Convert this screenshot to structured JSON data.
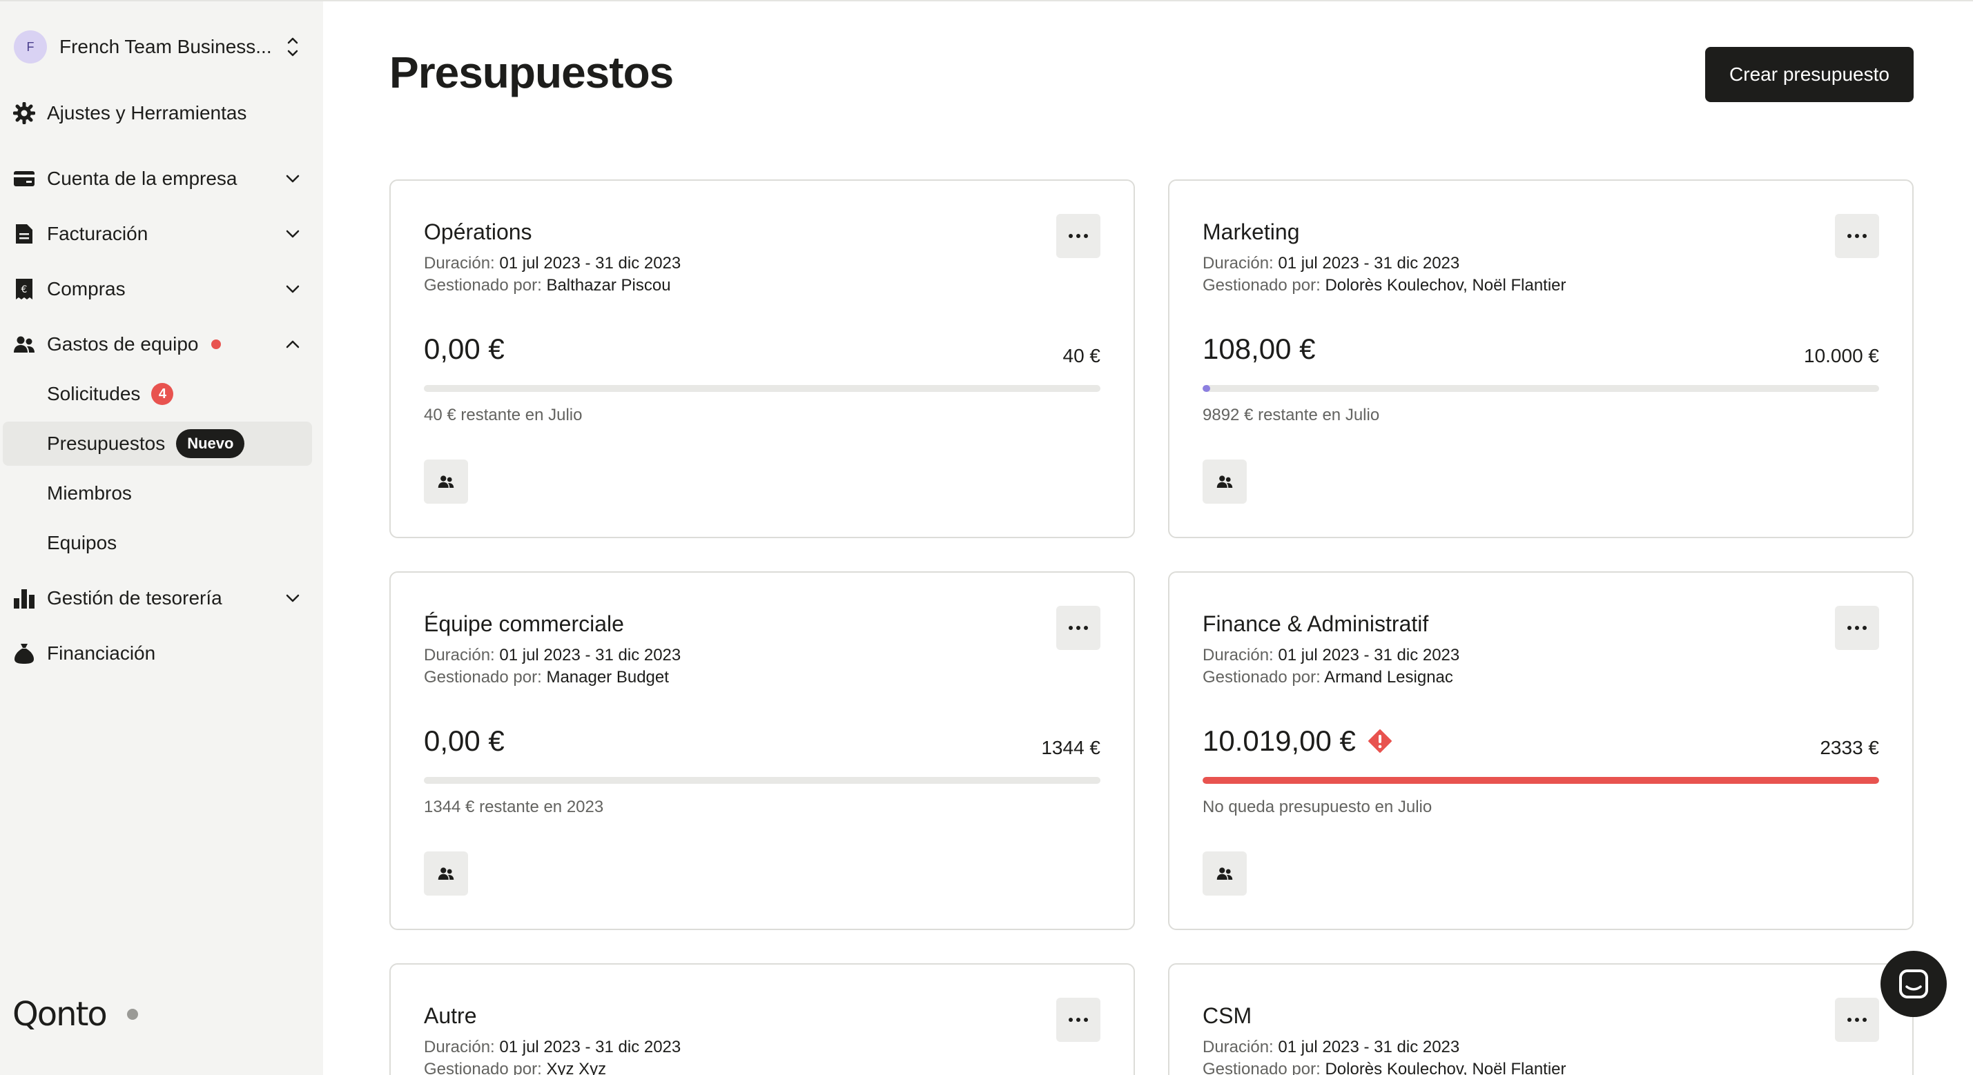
{
  "sidebar": {
    "org": {
      "initial": "F",
      "name": "French Team Business..."
    },
    "settings_label": "Ajustes y Herramientas",
    "items": [
      {
        "label": "Cuenta de la empresa"
      },
      {
        "label": "Facturación"
      },
      {
        "label": "Compras"
      },
      {
        "label": "Gastos de equipo"
      },
      {
        "label": "Gestión de tesorería"
      },
      {
        "label": "Financiación"
      }
    ],
    "sub_items": [
      {
        "label": "Solicitudes",
        "count": "4"
      },
      {
        "label": "Presupuestos",
        "badge": "Nuevo"
      },
      {
        "label": "Miembros"
      },
      {
        "label": "Equipos"
      }
    ],
    "brand": "Qonto"
  },
  "main": {
    "title": "Presupuestos",
    "create_label": "Crear presupuesto"
  },
  "labels": {
    "duration": "Duración:",
    "managed_by": "Gestionado por:"
  },
  "budgets": [
    {
      "name": "Opérations",
      "duration": "01 jul 2023 - 31 dic 2023",
      "managers": "Balthazar Piscou",
      "spent": "0,00 €",
      "limit": "40 €",
      "progress": 0,
      "remaining": "40 € restante en Julio"
    },
    {
      "name": "Marketing",
      "duration": "01 jul 2023 - 31 dic 2023",
      "managers": "Dolorès Koulechov, Noël Flantier",
      "spent": "108,00 €",
      "limit": "10.000 €",
      "progress": 0.0108,
      "remaining": "9892 € restante en Julio"
    },
    {
      "name": "Équipe commerciale",
      "duration": "01 jul 2023 - 31 dic 2023",
      "managers": "Manager Budget",
      "spent": "0,00 €",
      "limit": "1344 €",
      "progress": 0,
      "remaining": "1344 € restante en 2023"
    },
    {
      "name": "Finance & Administratif",
      "duration": "01 jul 2023 - 31 dic 2023",
      "managers": "Armand Lesignac",
      "spent": "10.019,00 €",
      "limit": "2333 €",
      "progress": 1,
      "remaining": "No queda presupuesto en Julio",
      "over_budget": true
    },
    {
      "name": "Autre",
      "duration": "01 jul 2023 - 31 dic 2023",
      "managers": "Xyz Xyz"
    },
    {
      "name": "CSM",
      "duration": "01 jul 2023 - 31 dic 2023",
      "managers": "Dolorès Koulechov, Noël Flantier"
    }
  ],
  "colors": {
    "progress_normal": "#8c7fe0",
    "progress_over": "#e8534f",
    "accent_dark": "#1d1d1b",
    "alert_red": "#e8534f"
  }
}
